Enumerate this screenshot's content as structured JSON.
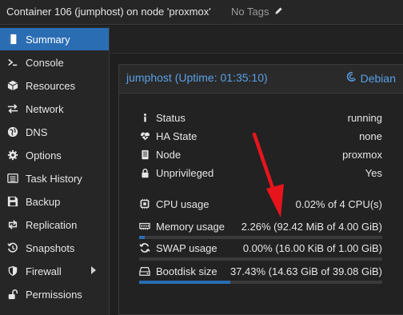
{
  "header": {
    "title": "Container 106 (jumphost) on node 'proxmox'",
    "tags": "No Tags"
  },
  "sidebar": {
    "items": [
      {
        "label": "Summary",
        "icon": "book-icon",
        "active": true
      },
      {
        "label": "Console",
        "icon": "terminal-icon"
      },
      {
        "label": "Resources",
        "icon": "cube-icon"
      },
      {
        "label": "Network",
        "icon": "exchange-icon"
      },
      {
        "label": "DNS",
        "icon": "globe-icon"
      },
      {
        "label": "Options",
        "icon": "gear-icon"
      },
      {
        "label": "Task History",
        "icon": "list-icon"
      },
      {
        "label": "Backup",
        "icon": "floppy-icon"
      },
      {
        "label": "Replication",
        "icon": "retweet-icon"
      },
      {
        "label": "Snapshots",
        "icon": "history-icon"
      },
      {
        "label": "Firewall",
        "icon": "shield-icon",
        "has_submenu": true
      },
      {
        "label": "Permissions",
        "icon": "unlock-icon"
      }
    ]
  },
  "panel": {
    "title": "jumphost (Uptime: 01:35:10)",
    "os": "Debian",
    "status": [
      {
        "label": "Status",
        "value": "running",
        "icon": "info-icon"
      },
      {
        "label": "HA State",
        "value": "none",
        "icon": "heartbeat-icon"
      },
      {
        "label": "Node",
        "value": "proxmox",
        "icon": "server-icon"
      },
      {
        "label": "Unprivileged",
        "value": "Yes",
        "icon": "lock-icon"
      }
    ],
    "usage": [
      {
        "label": "CPU usage",
        "value": "0.02% of 4 CPU(s)",
        "percent": 0.02,
        "icon": "cpu-icon",
        "bar": false
      },
      {
        "label": "Memory usage",
        "value": "2.26% (92.42 MiB of 4.00 GiB)",
        "percent": 2.26,
        "icon": "memory-icon",
        "bar": true
      },
      {
        "label": "SWAP usage",
        "value": "0.00% (16.00 KiB of 1.00 GiB)",
        "percent": 0.0,
        "icon": "refresh-icon",
        "bar": true
      },
      {
        "label": "Bootdisk size",
        "value": "37.43% (14.63 GiB of 39.08 GiB)",
        "percent": 37.43,
        "icon": "hdd-icon",
        "bar": true
      }
    ]
  },
  "colors": {
    "accent": "#2a6db3",
    "link": "#5aa0e6",
    "annotation_arrow": "#e8141c"
  }
}
